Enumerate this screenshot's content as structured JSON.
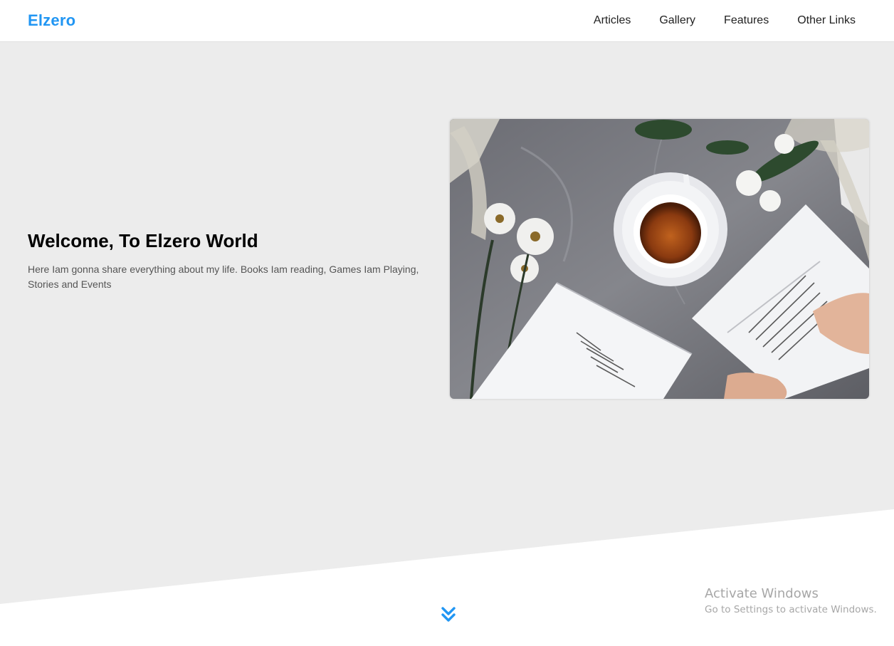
{
  "header": {
    "logo": "Elzero",
    "nav": [
      {
        "label": "Articles"
      },
      {
        "label": "Gallery"
      },
      {
        "label": "Features"
      },
      {
        "label": "Other Links"
      }
    ]
  },
  "hero": {
    "title": "Welcome, To Elzero World",
    "description": "Here Iam gonna share everything about my life. Books Iam reading, Games Iam Playing, Stories and Events",
    "image_icon": "books-and-tea-photo"
  },
  "scroll_icon": "double-chevron-down-icon",
  "watermark": {
    "title": "Activate Windows",
    "subtitle": "Go to Settings to activate Windows."
  },
  "colors": {
    "brand": "#2196f3",
    "hero_background": "#ececec",
    "header_background": "#ffffff"
  }
}
